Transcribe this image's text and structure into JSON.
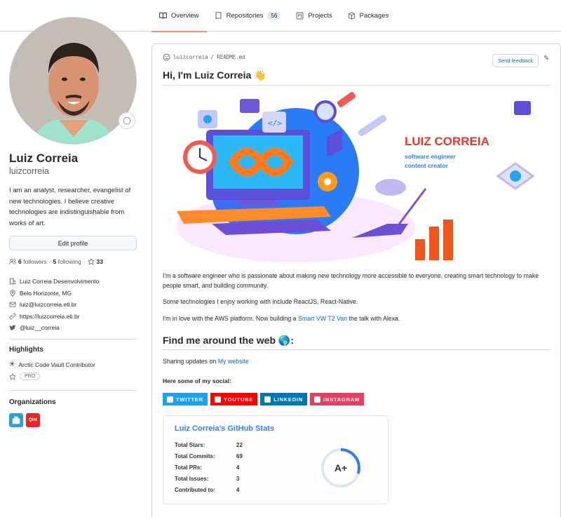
{
  "nav": {
    "tabs": [
      {
        "label": "Overview",
        "icon": "book-icon",
        "active": true
      },
      {
        "label": "Repositories",
        "icon": "repo-icon",
        "count": "56"
      },
      {
        "label": "Projects",
        "icon": "project-icon"
      },
      {
        "label": "Packages",
        "icon": "package-icon"
      }
    ]
  },
  "profile": {
    "name": "Luiz Correia",
    "login": "luizcorreia",
    "bio": "I am an analyst, researcher, evangelist of new technologies. I believe creative technologies are indistinguishable from works of art.",
    "edit_label": "Edit profile",
    "followers_count": "6",
    "followers_label": "followers",
    "following_count": "5",
    "following_label": "following",
    "stars_count": "33",
    "company": "Luiz Correia Desenvolvimento",
    "location": "Belo Horizonte, MG",
    "email": "luiz@luizcorreia.eti.br",
    "website": "https://luizcorreia.eti.br",
    "twitter": "@luiz__correia"
  },
  "highlights": {
    "title": "Highlights",
    "items": [
      "Arctic Code Vault Contributor"
    ],
    "pro_label": "PRO"
  },
  "organizations": {
    "title": "Organizations",
    "colors": [
      "#2aa1d8",
      "#e8262b"
    ],
    "second_label": "Qint"
  },
  "readme": {
    "path_user": "luizcorreia",
    "path_sep": "/",
    "path_file": "README.md",
    "feedback_label": "Send feedback",
    "title": "Hi, I'm Luiz Correia 👋",
    "banner": {
      "name": "LUIZ CORREIA",
      "role1": "software engineer",
      "role2": "content creator"
    },
    "p1": "I'm a software engineer who is passionate about making new technology more accessible to everyone, creating smart technology to make people smart, and building community.",
    "p2": "Some technologies I enjoy working with include ReactJS, React-Native.",
    "p3_before": "I'm in love with the AWS platform. Now building a ",
    "p3_link": "Smart VW T2 Van",
    "p3_after": " the talk with Alexa.",
    "h2": "Find me around the web 🌎:",
    "sharing_before": "Sharing updates on ",
    "sharing_link": "My website",
    "social_title": "Here some of my social:",
    "socials": [
      {
        "label": "TWITTER",
        "color": "#1ca0f2"
      },
      {
        "label": "YOUTUBE",
        "color": "#ff0000"
      },
      {
        "label": "LINKEDIN",
        "color": "#0077b5"
      },
      {
        "label": "INSTAGRAM",
        "color": "#e4405f"
      }
    ],
    "stats": {
      "title": "Luiz Correia's GitHub Stats",
      "rows": [
        {
          "label": "Total Stars:",
          "value": "22"
        },
        {
          "label": "Total Commits:",
          "value": "69"
        },
        {
          "label": "Total PRs:",
          "value": "4"
        },
        {
          "label": "Total Issues:",
          "value": "3"
        },
        {
          "label": "Contributed to:",
          "value": "4"
        }
      ],
      "grade": "A+",
      "grade_fraction": 0.3
    }
  }
}
